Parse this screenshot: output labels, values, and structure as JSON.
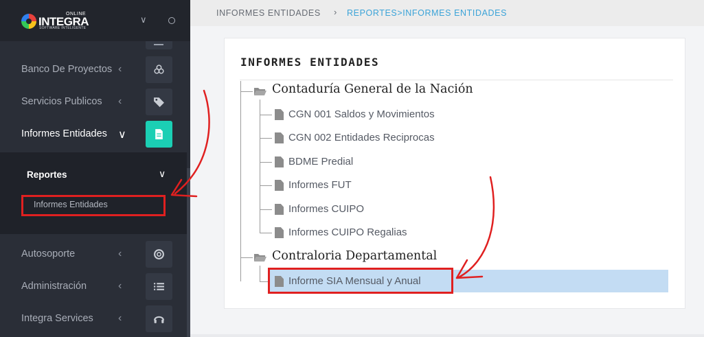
{
  "brand": {
    "online": "ONLINE",
    "name": "INTEGRA",
    "tagline": "SOFTWARE INTELIGENTE"
  },
  "sidebar": {
    "items": [
      {
        "label": "Banco De Proyectos",
        "icon": "cubes-icon"
      },
      {
        "label": "Servicios Publicos",
        "icon": "tags-icon"
      },
      {
        "label": "Informes Entidades",
        "icon": "file-icon",
        "active": true
      },
      {
        "label": "Autosoporte",
        "icon": "life-ring-icon"
      },
      {
        "label": "Administración",
        "icon": "list-icon"
      },
      {
        "label": "Integra Services",
        "icon": "headset-icon"
      }
    ],
    "submenu": {
      "heading": "Reportes",
      "item": "Informes Entidades"
    }
  },
  "breadcrumb": {
    "home": "INFORMES ENTIDADES",
    "current": "REPORTES>INFORMES ENTIDADES"
  },
  "panel": {
    "title": "INFORMES ENTIDADES",
    "tree": [
      {
        "label": "Contaduría General de la Nación",
        "children": [
          "CGN 001 Saldos y Movimientos",
          "CGN 002 Entidades Reciprocas",
          "BDME Predial",
          "Informes FUT",
          "Informes CUIPO",
          "Informes CUIPO Regalias"
        ]
      },
      {
        "label": "Contraloria Departamental",
        "children": [
          "Informe SIA Mensual y Anual"
        ]
      }
    ],
    "selected": "Informe SIA Mensual y Anual"
  },
  "colors": {
    "accent": "#1bcfb4",
    "sidebar_bg": "#2a2e37",
    "highlight": "#c3dcf3",
    "annotation": "#e02020",
    "breadcrumb_link": "#3aa3d8"
  }
}
